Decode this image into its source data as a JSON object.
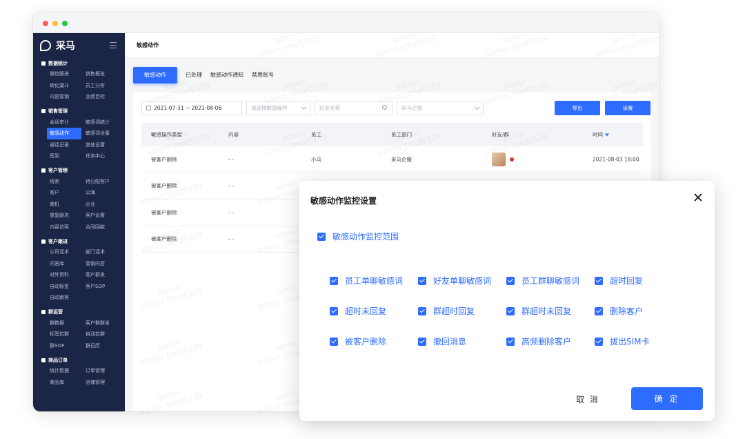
{
  "app": {
    "logo": "采马",
    "page_title": "敏感动作"
  },
  "sidebar": {
    "sections": [
      {
        "title": "数据统计",
        "items": [
          "微信跟进",
          "销售概览",
          "转化漏斗",
          "员工分析",
          "内容营销",
          "业绩目标"
        ]
      },
      {
        "title": "销售管理",
        "items": [
          "会话审计",
          "敏感词统计",
          "敏感动作",
          "敏感词设置",
          "通话记录",
          "其他设置",
          "签到",
          "任务中心"
        ]
      },
      {
        "title": "客户管理",
        "items": [
          "线索",
          "待分配客户",
          "客户",
          "公海",
          "商机",
          "企业",
          "重复跟进",
          "客户设置",
          "内容访客",
          "合同回款"
        ]
      },
      {
        "title": "客户跟进",
        "items": [
          "公司话术",
          "部门话术",
          "问答库",
          "营销内容",
          "对外资料",
          "客户群发",
          "自动标签",
          "客户SOP",
          "自动跟客"
        ]
      },
      {
        "title": "群运营",
        "items": [
          "群数据",
          "客户群群发",
          "标签拉群",
          "自动拉群",
          "群SOP",
          "群日历"
        ]
      },
      {
        "title": "商品订单",
        "items": [
          "统计数据",
          "订单管理",
          "商品库",
          "店铺管理"
        ]
      }
    ],
    "active_item": "敏感动作"
  },
  "tabs": [
    "敏感动作",
    "已处理",
    "敏感动作通知",
    "禁用账号"
  ],
  "filters": {
    "date_range": "2021-07-31 ~ 2021-08-06",
    "action_placeholder": "请选择敏感操作",
    "friend_placeholder": "好友名称",
    "company_placeholder": "采马企服",
    "export_label": "导出",
    "settings_label": "设置"
  },
  "table": {
    "headers": [
      "敏感操作类型",
      "内容",
      "员工",
      "员工部门",
      "好友/群",
      "时间"
    ],
    "rows": [
      {
        "type": "被客户删除",
        "content": "- -",
        "employee": "小马",
        "department": "采马企服",
        "time": "2021-08-03 18:00",
        "has_avatar": true
      },
      {
        "type": "被客户删除",
        "content": "- -",
        "employee": "",
        "department": "",
        "time": "",
        "has_avatar": false
      },
      {
        "type": "被客户删除",
        "content": "- -",
        "employee": "",
        "department": "",
        "time": "",
        "has_avatar": false
      },
      {
        "type": "被客户删除",
        "content": "- -",
        "employee": "",
        "department": "",
        "time": "",
        "has_avatar": false
      }
    ]
  },
  "watermark": {
    "line1": "admin",
    "line2": "admin_tmqf0109"
  },
  "modal": {
    "title": "敏感动作监控设置",
    "scope_label": "敏感动作监控范围",
    "options": [
      "员工单聊敏感词",
      "好友单聊敏感词",
      "员工群聊敏感词",
      "超时回复",
      "超时未回复",
      "群超时回复",
      "群超时未回复",
      "删除客户",
      "被客户删除",
      "撤回消息",
      "高频删除客户",
      "拔出SIM卡"
    ],
    "cancel_label": "取 消",
    "ok_label": "确 定"
  },
  "colors": {
    "accent": "#2e6bff",
    "sidebar_bg": "#1b2545"
  }
}
